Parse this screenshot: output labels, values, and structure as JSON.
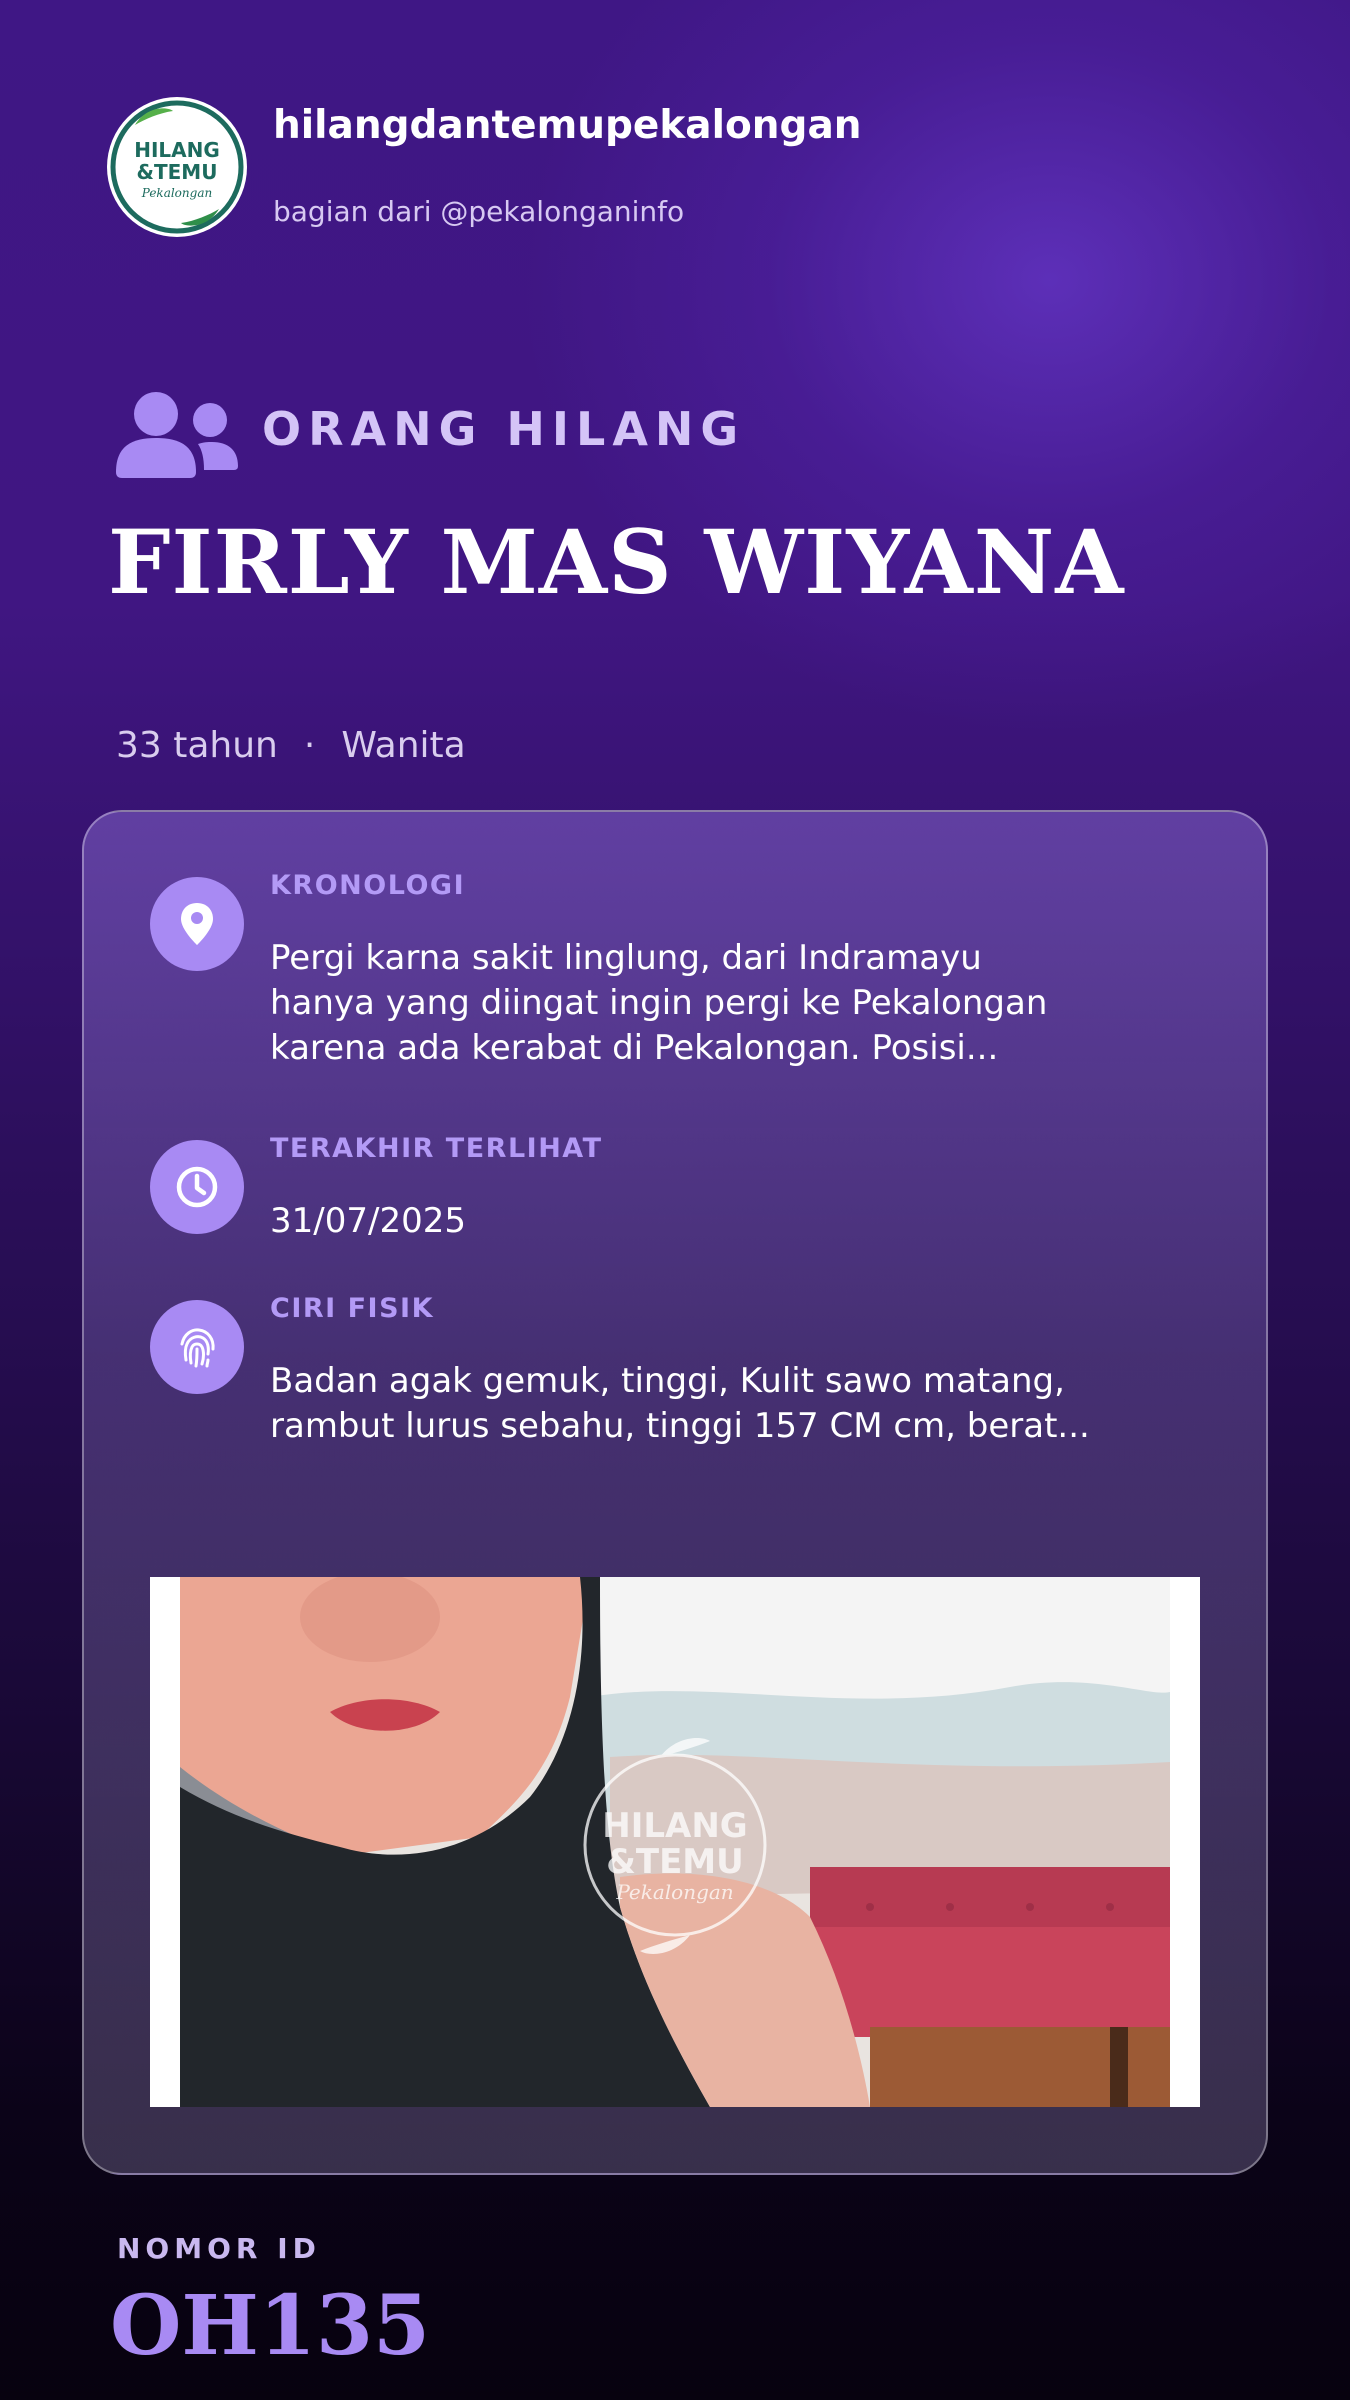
{
  "header": {
    "username": "hilangdantemupekalongan",
    "subtitle": "bagian dari @pekalonganinfo",
    "logo": {
      "line1": "HILANG",
      "line2": "&TEMU",
      "line3": "Pekalongan"
    }
  },
  "category": {
    "icon": "users-icon",
    "label": "ORANG HILANG"
  },
  "person": {
    "name": "FIRLY MAS WIYANA",
    "age": "33 tahun",
    "separator": "·",
    "gender": "Wanita"
  },
  "details": [
    {
      "icon": "map-pin-icon",
      "label": "KRONOLOGI",
      "lines": [
        "Pergi karna sakit linglung, dari Indramayu",
        "hanya yang diingat ingin pergi ke Pekalongan",
        "karena ada kerabat di Pekalongan. Posisi..."
      ]
    },
    {
      "icon": "clock-icon",
      "label": "TERAKHIR TERLIHAT",
      "lines": [
        "31/07/2025"
      ]
    },
    {
      "icon": "fingerprint-icon",
      "label": "CIRI FISIK",
      "lines": [
        "Badan agak gemuk, tinggi, Kulit sawo matang,",
        "rambut lurus sebahu, tinggi 157 CM cm, berat..."
      ]
    }
  ],
  "photo": {
    "watermark": {
      "line1": "HILANG",
      "line2": "&TEMU",
      "line3": "Pekalongan"
    }
  },
  "footer": {
    "id_label": "NOMOR ID",
    "id_value": "OH135"
  },
  "colors": {
    "accent": "#a88af3",
    "label": "#b39af6",
    "background_top": "#3f1785",
    "background_bottom": "#07020f",
    "logo_text": "#1d6b5e",
    "logo_leaf": "#3e9b4f"
  }
}
